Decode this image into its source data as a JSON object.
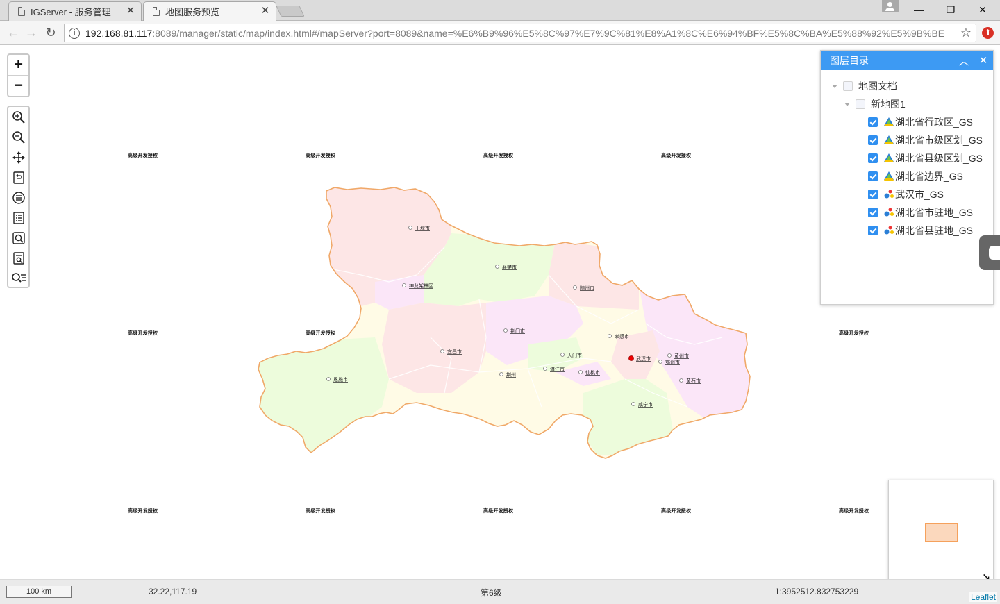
{
  "browser": {
    "tabs": [
      {
        "title": "IGServer - 服务管理",
        "active": false
      },
      {
        "title": "地图服务预览",
        "active": true
      }
    ],
    "url_host": "192.168.81.117",
    "url_rest": ":8089/manager/static/map/index.html#/mapServer?port=8089&name=%E6%B9%96%E5%8C%97%E7%9C%81%E8%A1%8C%E6%94%BF%E5%8C%BA%E5%88%92%E5%9B%BE"
  },
  "map": {
    "watermark_text": "高级开发授权",
    "cities": [
      {
        "name": "十堰市"
      },
      {
        "name": "襄樊市"
      },
      {
        "name": "神龙架林区"
      },
      {
        "name": "随州市"
      },
      {
        "name": "荆门市"
      },
      {
        "name": "孝感市"
      },
      {
        "name": "黄州市"
      },
      {
        "name": "宜昌市"
      },
      {
        "name": "天门市"
      },
      {
        "name": "武汉市"
      },
      {
        "name": "鄂州市"
      },
      {
        "name": "恩施市"
      },
      {
        "name": "潜江市"
      },
      {
        "name": "荆州"
      },
      {
        "name": "仙桃市"
      },
      {
        "name": "黄石市"
      },
      {
        "name": "咸宁市"
      }
    ],
    "colors": {
      "province_border": "#f0a868",
      "pink": "#fde6e6",
      "green": "#edfcdc",
      "magenta": "#fbe6f8",
      "yellow": "#fffbe6",
      "accent": "#3d9af3"
    }
  },
  "controls": {
    "zoom_in": "+",
    "zoom_out": "−",
    "tools": [
      "zoom-in-tool-icon",
      "zoom-out-tool-icon",
      "pan-icon",
      "restore-icon",
      "list-icon",
      "document-list-icon",
      "query-icon",
      "attribute-query-icon",
      "search-list-icon"
    ]
  },
  "layer_panel": {
    "title": "图层目录",
    "root": "地图文档",
    "map_name": "新地图1",
    "layers": [
      {
        "name": "湖北省行政区_GS",
        "type": "polygon",
        "checked": true
      },
      {
        "name": "湖北省市级区划_GS",
        "type": "polygon",
        "checked": true
      },
      {
        "name": "湖北省县级区划_GS",
        "type": "polygon",
        "checked": true
      },
      {
        "name": "湖北省边界_GS",
        "type": "polygon",
        "checked": true
      },
      {
        "name": "武汉市_GS",
        "type": "point",
        "checked": true
      },
      {
        "name": "湖北省市驻地_GS",
        "type": "point",
        "checked": true
      },
      {
        "name": "湖北省县驻地_GS",
        "type": "point",
        "checked": true
      }
    ]
  },
  "status": {
    "scale_label": "100 km",
    "coordinates": "32.22,117.19",
    "zoom_level": "第6级",
    "scale_ratio": "1:3952512.832753229",
    "attribution": "Leaflet"
  }
}
